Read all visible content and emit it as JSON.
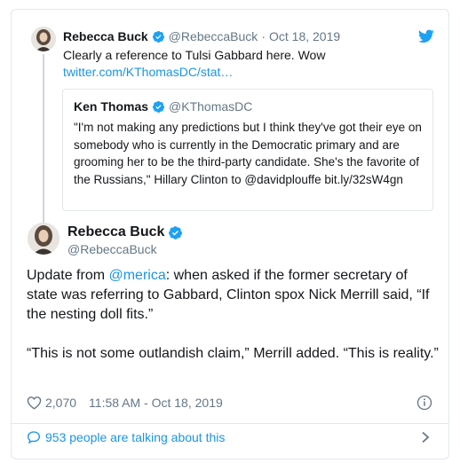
{
  "parent_tweet": {
    "name": "Rebecca Buck",
    "handle": "@RebeccaBuck",
    "separator": "·",
    "date": "Oct 18, 2019",
    "text": "Clearly a reference to Tulsi Gabbard here. Wow",
    "link": "twitter.com/KThomasDC/stat…"
  },
  "quoted_tweet": {
    "name": "Ken Thomas",
    "handle": "@KThomasDC",
    "text": "\"I'm not making any predictions but I think they've got their eye on somebody who is currently in the Democratic primary and are grooming her to be the third-party candidate. She's the favorite of the Russians,\" Hillary Clinton to @davidplouffe bit.ly/32sW4gn"
  },
  "main_tweet": {
    "name": "Rebecca Buck",
    "handle": "@RebeccaBuck",
    "paragraph1_prefix": "Update from ",
    "paragraph1_mention": "@merica",
    "paragraph1_suffix": ": when asked if the former secretary of state was referring to Gabbard, Clinton spox Nick Merrill said, “If the nesting doll fits.”",
    "paragraph2": "“This is not some outlandish claim,” Merrill added. “This is reality.”",
    "likes": "2,070",
    "timestamp": "11:58 AM - Oct 18, 2019"
  },
  "footer": {
    "talking_label": "953 people are talking about this"
  },
  "colors": {
    "accent": "#1b95e0",
    "verified": "#1da1f2",
    "muted": "#657786",
    "border": "#e1e8ed"
  },
  "icons": [
    "verified-badge-icon",
    "twitter-bird-icon",
    "heart-icon",
    "info-icon",
    "speech-bubble-icon",
    "chevron-right-icon"
  ]
}
